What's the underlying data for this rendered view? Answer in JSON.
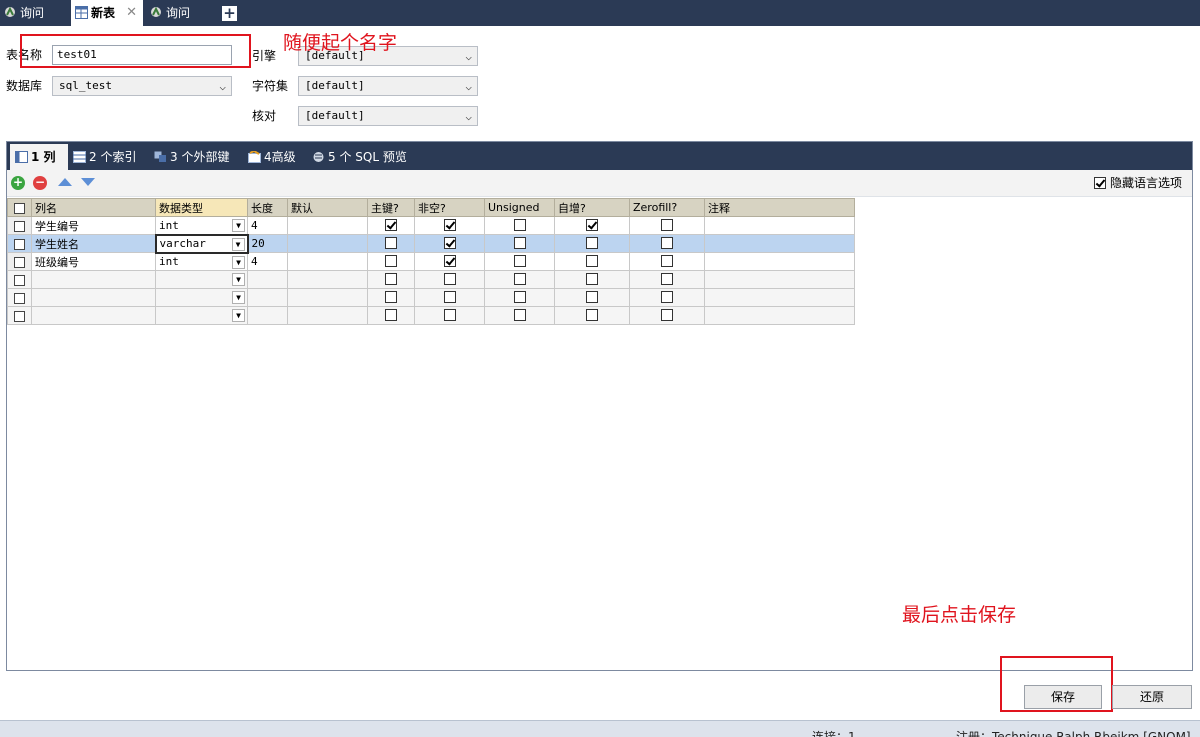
{
  "tabs": [
    {
      "label": "询问",
      "active": false,
      "icon": "query-icon"
    },
    {
      "label": "新表",
      "active": true,
      "icon": "table-icon",
      "closable": true
    },
    {
      "label": "询问",
      "active": false,
      "icon": "query-icon"
    }
  ],
  "add_tab_label": "+",
  "form": {
    "table_name_label": "表名称",
    "table_name_value": "test01",
    "database_label": "数据库",
    "database_value": "sql_test",
    "engine_label": "引擎",
    "engine_value": "[default]",
    "charset_label": "字符集",
    "charset_value": "[default]",
    "collation_label": "核对",
    "collation_value": "[default]"
  },
  "annotations": {
    "name_hint": "随便起个名字",
    "save_hint": "最后点击保存"
  },
  "subtabs": [
    {
      "label": "1 列",
      "active": true,
      "icon": "columns-icon"
    },
    {
      "label": "2 个索引",
      "active": false,
      "icon": "index-icon"
    },
    {
      "label": "3 个外部键",
      "active": false,
      "icon": "foreign-key-icon"
    },
    {
      "label": "4高级",
      "active": false,
      "icon": "advanced-icon"
    },
    {
      "label": "5 个 SQL 预览",
      "active": false,
      "icon": "sql-preview-icon"
    }
  ],
  "toolbar": {
    "hide_language_label": "隐藏语言选项",
    "hide_language_checked": true
  },
  "grid": {
    "headers": [
      "列名",
      "数据类型",
      "长度",
      "默认",
      "主键?",
      "非空?",
      "Unsigned",
      "自增?",
      "Zerofill?",
      "注释"
    ],
    "rows": [
      {
        "name": "学生编号",
        "type": "int",
        "length": "4",
        "default": "",
        "pk": true,
        "notnull": true,
        "unsigned": false,
        "autoinc": true,
        "zerofill": false,
        "comment": ""
      },
      {
        "name": "学生姓名",
        "type": "varchar",
        "length": "20",
        "default": "",
        "pk": false,
        "notnull": true,
        "unsigned": false,
        "autoinc": false,
        "zerofill": false,
        "comment": "",
        "selected": true
      },
      {
        "name": "班级编号",
        "type": "int",
        "length": "4",
        "default": "",
        "pk": false,
        "notnull": true,
        "unsigned": false,
        "autoinc": false,
        "zerofill": false,
        "comment": ""
      },
      {
        "name": "",
        "type": "",
        "length": "",
        "default": "",
        "pk": false,
        "notnull": false,
        "unsigned": false,
        "autoinc": false,
        "zerofill": false,
        "comment": ""
      },
      {
        "name": "",
        "type": "",
        "length": "",
        "default": "",
        "pk": false,
        "notnull": false,
        "unsigned": false,
        "autoinc": false,
        "zerofill": false,
        "comment": ""
      },
      {
        "name": "",
        "type": "",
        "length": "",
        "default": "",
        "pk": false,
        "notnull": false,
        "unsigned": false,
        "autoinc": false,
        "zerofill": false,
        "comment": ""
      }
    ]
  },
  "buttons": {
    "save": "保存",
    "revert": "还原"
  },
  "status": {
    "connection": "连接：1",
    "registration": "注册：Technique Ralph Rbejkm [GNOM]"
  },
  "colors": {
    "tab_bar": "#2b3a55",
    "annotation_red": "#e0141e",
    "selected_row": "#bcd4f0",
    "grid_header": "#d7d3c2"
  }
}
